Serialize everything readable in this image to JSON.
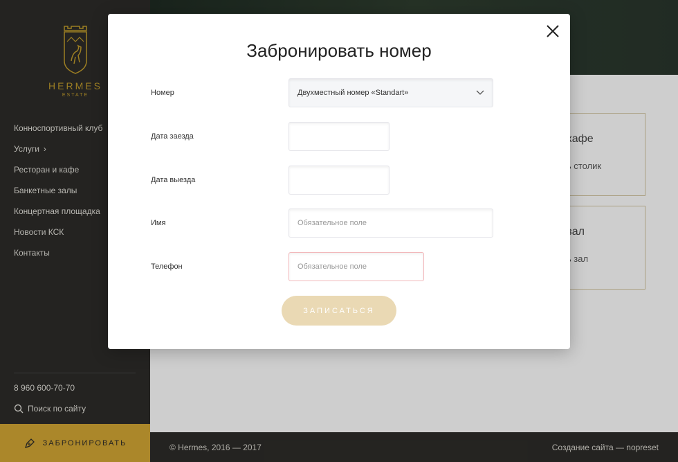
{
  "brand": {
    "name": "HERMES",
    "sub": "ESTATE"
  },
  "nav": [
    {
      "label": "Конноспортивный клуб"
    },
    {
      "label": "Услуги",
      "has_arrow": true
    },
    {
      "label": "Ресторан и кафе"
    },
    {
      "label": "Банкетные залы"
    },
    {
      "label": "Концертная площадка"
    },
    {
      "label": "Новости КСК"
    },
    {
      "label": "Контакты"
    }
  ],
  "phone": "8 960 600-70-70",
  "search_label": "Поиск по сайту",
  "book_button": "ЗАБРОНИРОВАТЬ",
  "background_cards": [
    {
      "title": "и кафе",
      "link": "ать столик"
    },
    {
      "title": "й зал",
      "link": "ать зал"
    }
  ],
  "footer": {
    "copyright": "© Hermes, 2016 — 2017",
    "credit": "Создание сайта — nopreset"
  },
  "modal": {
    "title": "Забронировать номер",
    "fields": {
      "room": {
        "label": "Номер",
        "value": "Двухместный номер «Standart»"
      },
      "checkin": {
        "label": "Дата заезда",
        "value": ""
      },
      "checkout": {
        "label": "Дата выезда",
        "value": ""
      },
      "name": {
        "label": "Имя",
        "placeholder": "Обязательное поле"
      },
      "phone": {
        "label": "Телефон",
        "placeholder": "Обязательное поле"
      }
    },
    "submit": "ЗАПИСАТЬСЯ"
  },
  "colors": {
    "accent": "#c99f32",
    "sidebar": "#2b2a27",
    "submit_disabled": "#ead9b4",
    "error_border": "#f2b8bb"
  }
}
